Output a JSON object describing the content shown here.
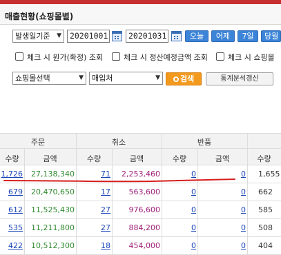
{
  "title": "매출현황(쇼핑몰별)",
  "filters": {
    "date_type": "발생일기준",
    "date_from": "20201001",
    "date_to": "20201031",
    "quick_buttons": [
      "오늘",
      "어제",
      "7일",
      "당월"
    ],
    "checkboxes": [
      "체크 시 원가(확정) 조회",
      "체크 시 정산예정금액 조회",
      "체크 시 쇼핑몰"
    ],
    "mall_select": "쇼핑몰선택",
    "vendor_select": "매입처",
    "search_label": "검색",
    "stats_label": "통계분석갱신"
  },
  "table": {
    "groups": [
      "주문",
      "취소",
      "반품"
    ],
    "sub_headers": [
      "수량",
      "금액",
      "수량",
      "금액",
      "수량",
      "금액",
      "수량"
    ],
    "rows": [
      [
        "1,726",
        "27,138,340",
        "71",
        "2,253,460",
        "0",
        "0",
        "1,655"
      ],
      [
        "679",
        "20,470,650",
        "17",
        "563,600",
        "0",
        "0",
        "662"
      ],
      [
        "612",
        "11,525,430",
        "27",
        "976,600",
        "0",
        "0",
        "585"
      ],
      [
        "535",
        "11,211,800",
        "27",
        "884,200",
        "0",
        "0",
        "508"
      ],
      [
        "422",
        "10,512,300",
        "18",
        "454,000",
        "0",
        "0",
        "404"
      ]
    ]
  },
  "colors": {
    "accent_red": "#c62f2f",
    "blue_button": "#3b84d8",
    "search_orange": "#f39a1e",
    "qty_blue": "#1a45b8",
    "amount_green": "#2f8a2f",
    "amount_purple": "#a0207a",
    "annotation_red": "#d81e1e"
  }
}
